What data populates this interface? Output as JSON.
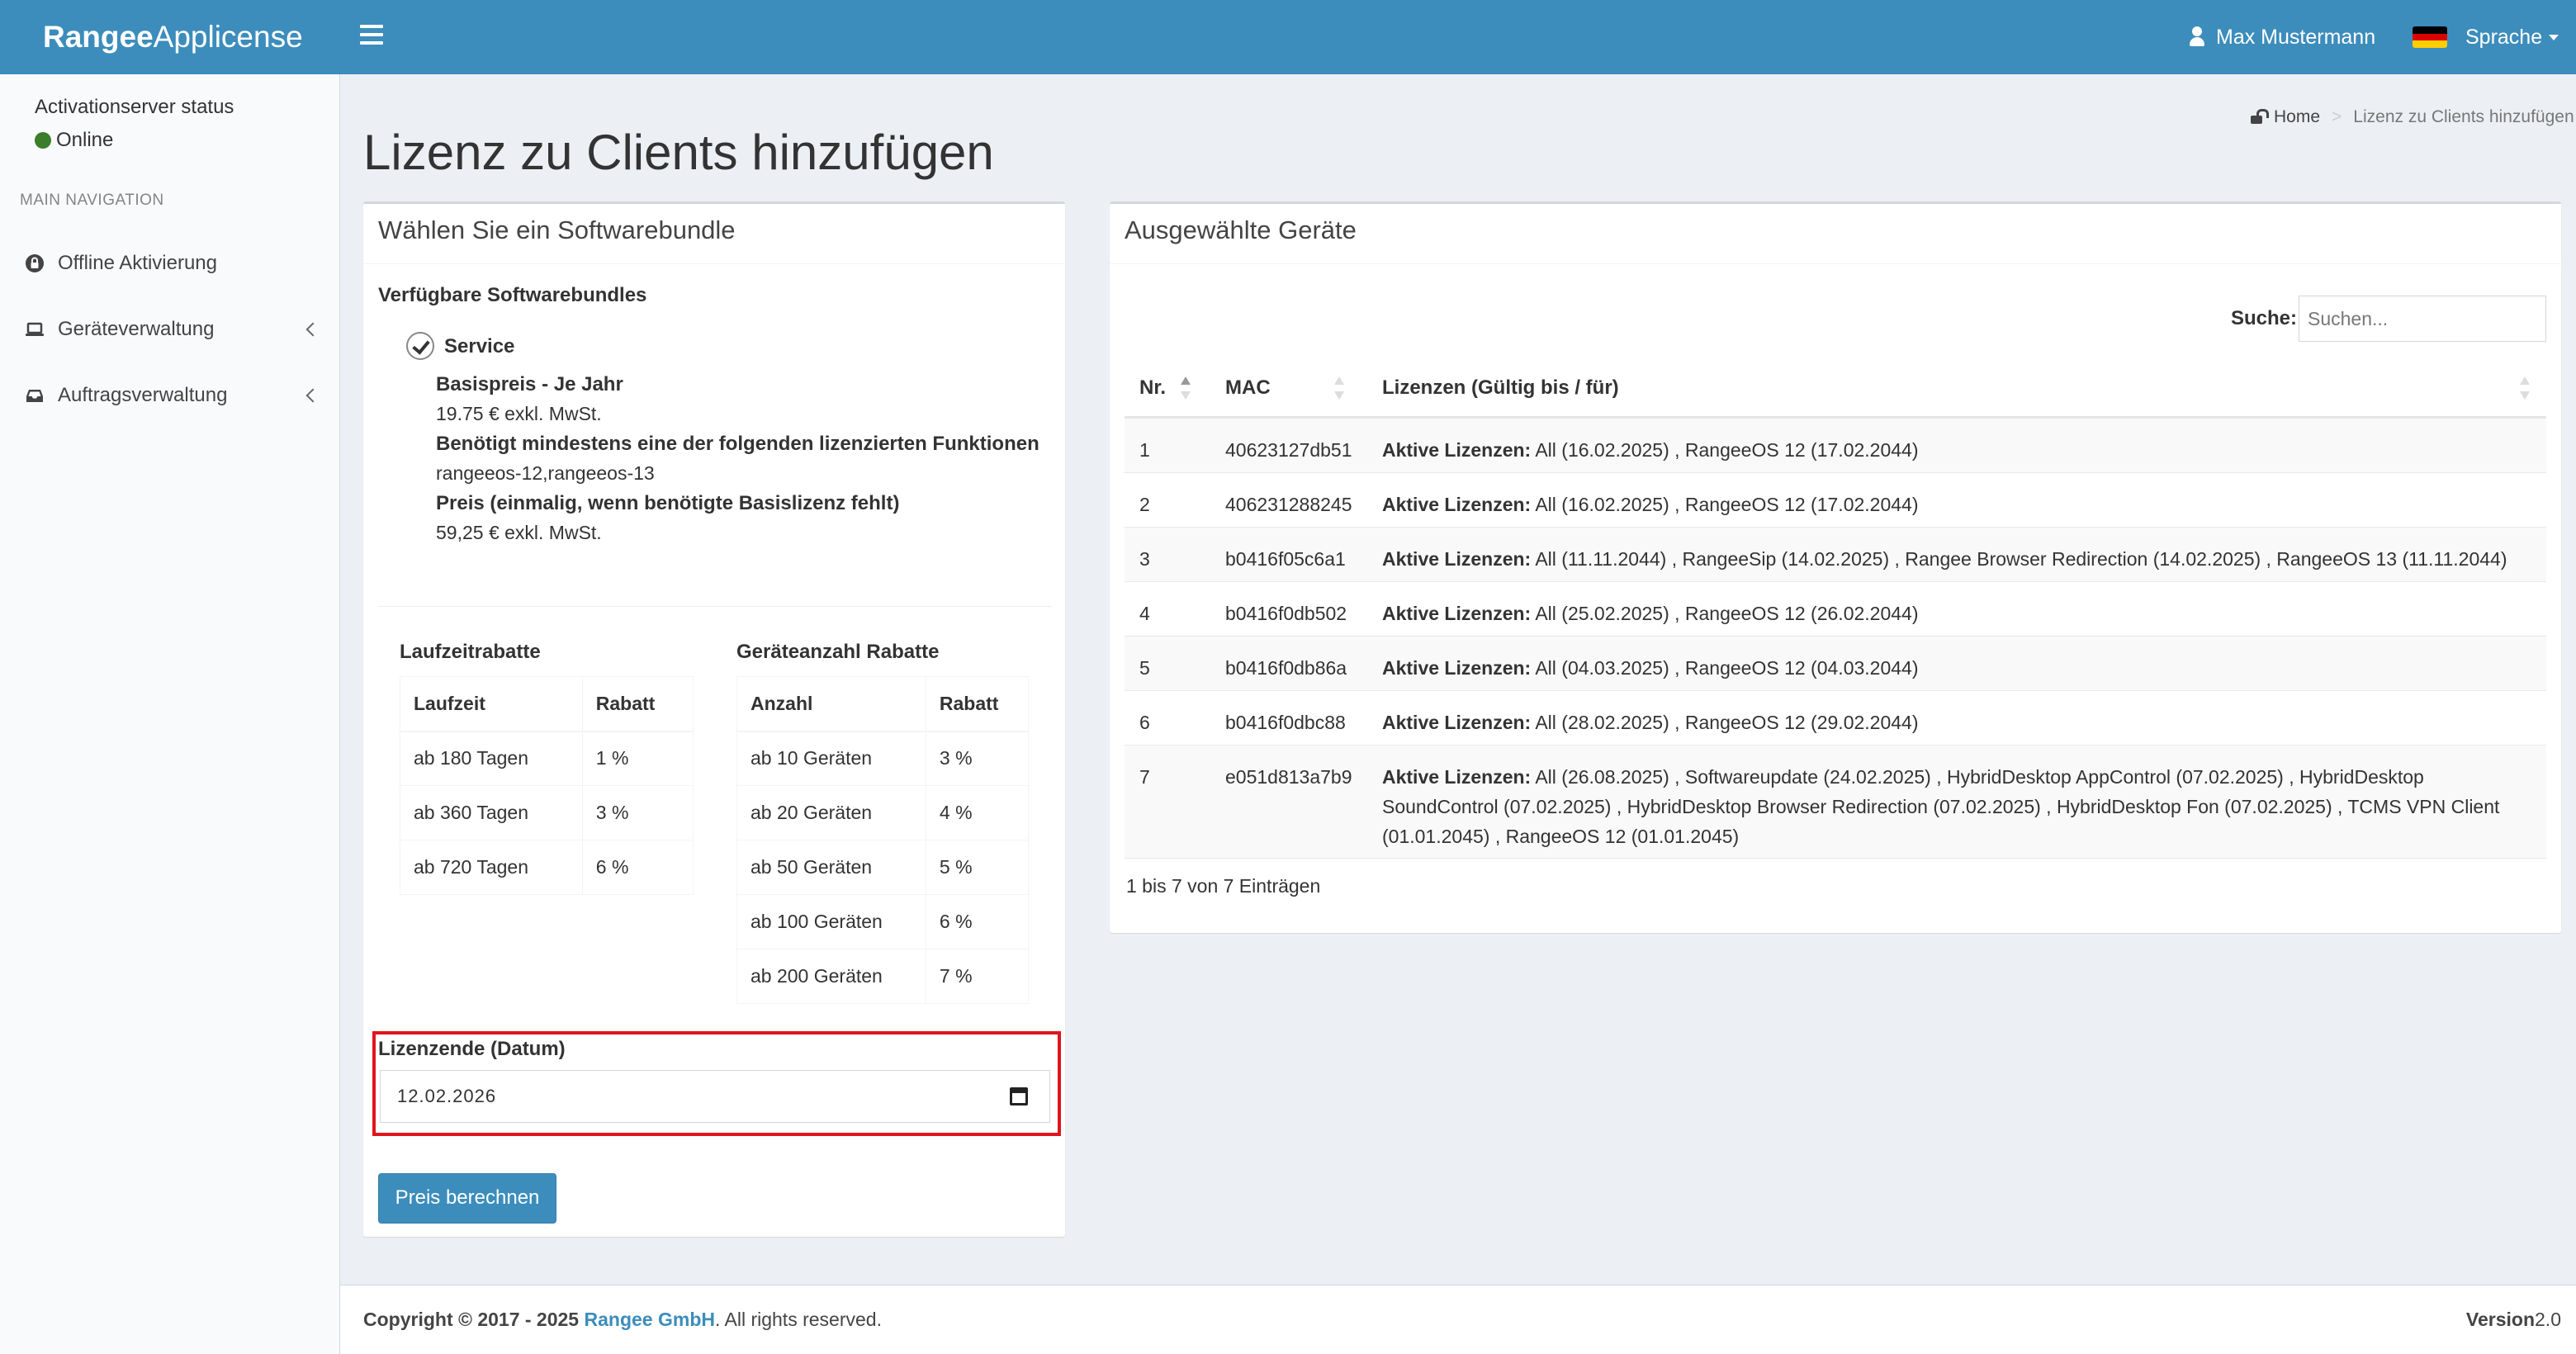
{
  "header": {
    "logo_bold": "Rangee",
    "logo_rest": "Applicense",
    "user_name": "Max Mustermann",
    "language_label": "Sprache",
    "flag_colors": [
      "#000000",
      "#dd0000",
      "#ffce00"
    ]
  },
  "sidebar": {
    "status_title": "Activationserver status",
    "status_value": "Online",
    "status_color": "#3a7d2a",
    "nav_header": "MAIN NAVIGATION",
    "items": [
      {
        "label": "Offline Aktivierung",
        "icon": "lock-icon"
      },
      {
        "label": "Geräteverwaltung",
        "icon": "laptop-icon"
      },
      {
        "label": "Auftragsverwaltung",
        "icon": "inbox-icon"
      }
    ]
  },
  "page": {
    "title": "Lizenz zu Clients hinzufügen",
    "breadcrumb_home": "Home",
    "breadcrumb_current": "Lizenz zu Clients hinzufügen"
  },
  "bundle_box": {
    "title": "Wählen Sie ein Softwarebundle",
    "available_label": "Verfügbare Softwarebundles",
    "bundle_name": "Service",
    "base_price_label": "Basispreis - Je Jahr",
    "base_price_value": "19.75 € exkl. MwSt.",
    "requires_label": "Benötigt mindestens eine der folgenden lizenzierten Funktionen",
    "requires_value": "rangeeos-12,rangeeos-13",
    "price_label": "Preis (einmalig, wenn benötigte Basislizenz fehlt)",
    "price_value": "59,25 € exkl. MwSt.",
    "duration_discount": {
      "title": "Laufzeitrabatte",
      "headers": [
        "Laufzeit",
        "Rabatt"
      ],
      "rows": [
        [
          "ab 180 Tagen",
          "1 %"
        ],
        [
          "ab 360 Tagen",
          "3 %"
        ],
        [
          "ab 720 Tagen",
          "6 %"
        ]
      ]
    },
    "device_discount": {
      "title": "Geräteanzahl Rabatte",
      "headers": [
        "Anzahl",
        "Rabatt"
      ],
      "rows": [
        [
          "ab 10 Geräten",
          "3 %"
        ],
        [
          "ab 20 Geräten",
          "4 %"
        ],
        [
          "ab 50 Geräten",
          "5 %"
        ],
        [
          "ab 100 Geräten",
          "6 %"
        ],
        [
          "ab 200 Geräten",
          "7 %"
        ]
      ]
    },
    "date_label": "Lizenzende (Datum)",
    "date_value": "12.02.2026",
    "calc_button": "Preis berechnen"
  },
  "devices_box": {
    "title": "Ausgewählte Geräte",
    "search_label": "Suche:",
    "search_placeholder": "Suchen...",
    "headers": [
      "Nr.",
      "MAC",
      "Lizenzen (Gültig bis / für)"
    ],
    "license_prefix": "Aktive Lizenzen:",
    "rows": [
      {
        "nr": "1",
        "mac": "40623127db51",
        "licenses": "All (16.02.2025) , RangeeOS 12 (17.02.2044)"
      },
      {
        "nr": "2",
        "mac": "406231288245",
        "licenses": "All (16.02.2025) , RangeeOS 12 (17.02.2044)"
      },
      {
        "nr": "3",
        "mac": "b0416f05c6a1",
        "licenses": "All (11.11.2044) , RangeeSip (14.02.2025) , Rangee Browser Redirection (14.02.2025) , RangeeOS 13 (11.11.2044)"
      },
      {
        "nr": "4",
        "mac": "b0416f0db502",
        "licenses": "All (25.02.2025) , RangeeOS 12 (26.02.2044)"
      },
      {
        "nr": "5",
        "mac": "b0416f0db86a",
        "licenses": "All (04.03.2025) , RangeeOS 12 (04.03.2044)"
      },
      {
        "nr": "6",
        "mac": "b0416f0dbc88",
        "licenses": "All (28.02.2025) , RangeeOS 12 (29.02.2044)"
      },
      {
        "nr": "7",
        "mac": "e051d813a7b9",
        "licenses": "All (26.08.2025) , Softwareupdate (24.02.2025) , HybridDesktop AppControl (07.02.2025) , HybridDesktop SoundControl (07.02.2025) , HybridDesktop Browser Redirection (07.02.2025) , HybridDesktop Fon (07.02.2025) , TCMS VPN Client (01.01.2045) , RangeeOS 12 (01.01.2045)"
      }
    ],
    "info": "1 bis 7 von 7 Einträgen"
  },
  "footer": {
    "copyright": "Copyright © 2017 - 2025",
    "company": "Rangee GmbH",
    "rights": ". All rights reserved.",
    "version_label": "Version",
    "version_value": "2.0"
  }
}
